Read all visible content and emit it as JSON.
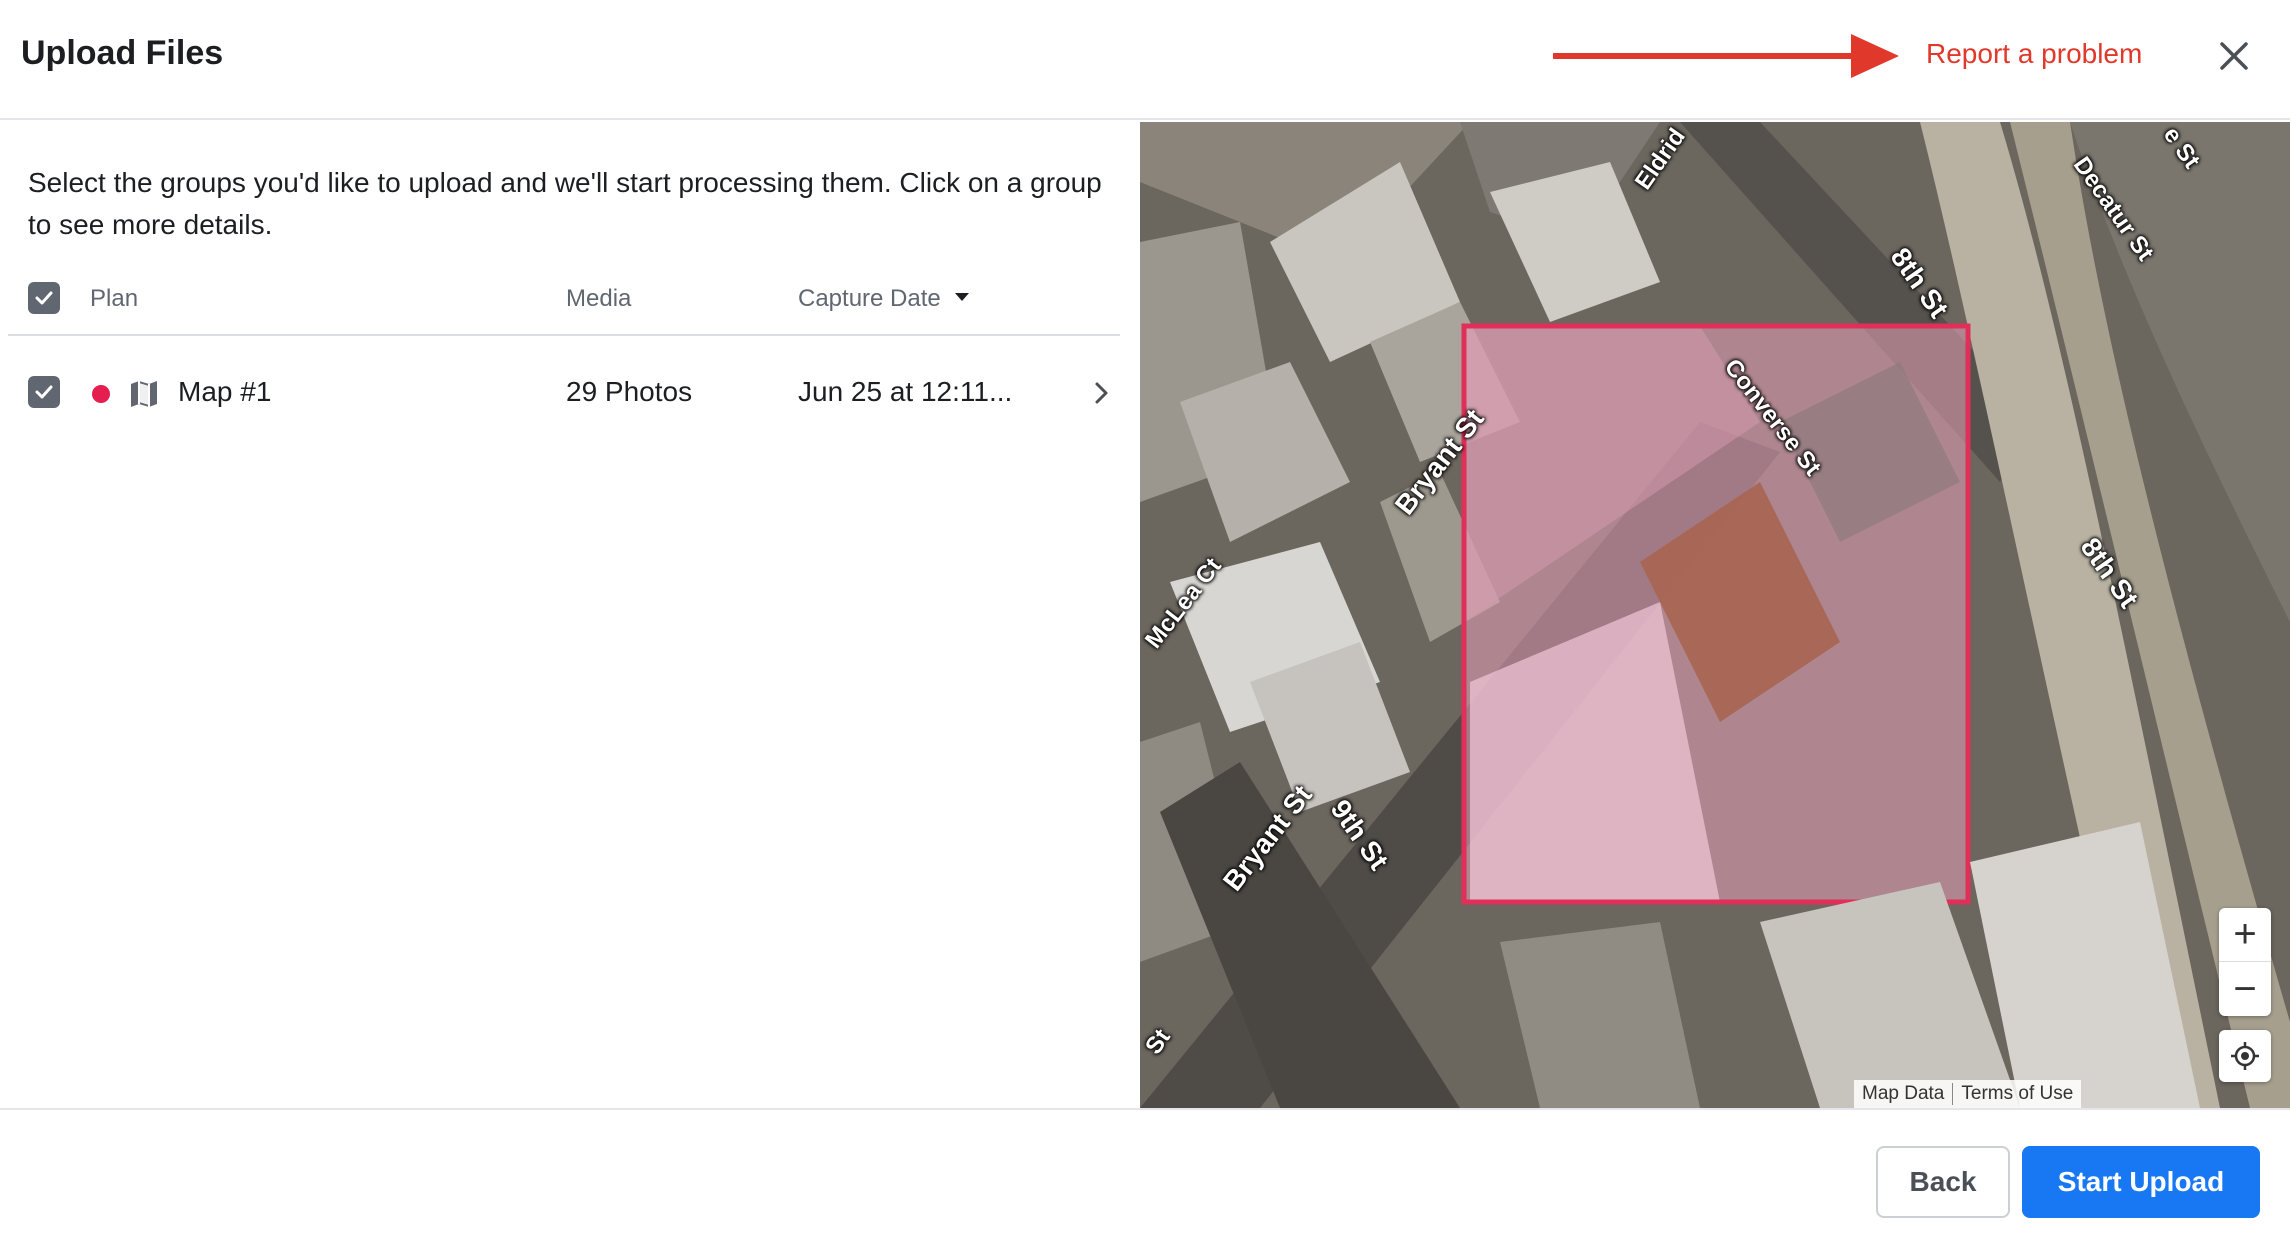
{
  "header": {
    "title": "Upload Files",
    "report_label": "Report a problem",
    "annotation_color": "#e0392b"
  },
  "instructions": "Select the groups you'd like to upload and we'll start processing them. Click on a group to see more details.",
  "table": {
    "columns": {
      "plan": "Plan",
      "media": "Media",
      "capture_date": "Capture Date"
    },
    "select_all_checked": true,
    "rows": [
      {
        "checked": true,
        "status_color": "#e41e4f",
        "icon": "map-icon",
        "name": "Map #1",
        "media": "29 Photos",
        "capture_date": "Jun 25 at 12:11..."
      }
    ]
  },
  "map": {
    "streets": [
      "Eldrid",
      "Decatur St",
      "8th St",
      "Bryant St",
      "Converse St",
      "McLea Ct",
      "8th St",
      "Bryant St",
      "9th St",
      "St",
      "e St"
    ],
    "highlight_color": "#e0305a",
    "zoom_in": "+",
    "zoom_out": "−",
    "attribution": {
      "map_data": "Map Data",
      "terms": "Terms of Use"
    }
  },
  "footer": {
    "back_label": "Back",
    "start_label": "Start Upload",
    "primary_color": "#1877f2"
  }
}
